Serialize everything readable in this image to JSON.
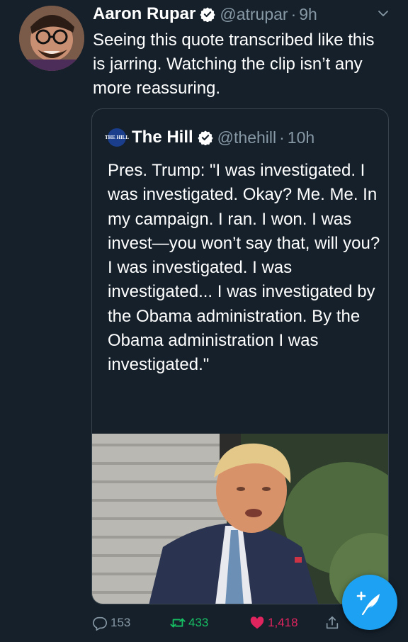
{
  "tweet": {
    "author_name": "Aaron Rupar",
    "handle": "@atrupar",
    "separator": "·",
    "time": "9h",
    "text": "Seeing this quote transcribed like this is jarring. Watching the clip isn’t any more reassuring."
  },
  "quoted": {
    "logo_text": "THE HILL",
    "author_name": "The Hill",
    "handle": "@thehill",
    "separator": "·",
    "time": "10h",
    "text": "Pres. Trump: \"I was investigated. I was investigated. Okay? Me. Me. In my campaign. I ran. I won. I was invest—you won’t say that, will you? I was investigated. I was investigated... I was investigated by the Obama administration. By the Obama administration I was investigated.\""
  },
  "actions": {
    "replies": "153",
    "retweets": "433",
    "likes": "1,418"
  },
  "icons": {
    "verified": "verified-badge-icon",
    "chevron": "chevron-down-icon",
    "reply": "reply-icon",
    "retweet": "retweet-icon",
    "like": "heart-icon",
    "share": "share-icon",
    "compose": "compose-tweet-icon"
  },
  "colors": {
    "background": "#15202b",
    "secondary_text": "#8899a6",
    "accent": "#1da1f2",
    "retweet_active": "#17bf63",
    "like_active": "#e0245e"
  }
}
